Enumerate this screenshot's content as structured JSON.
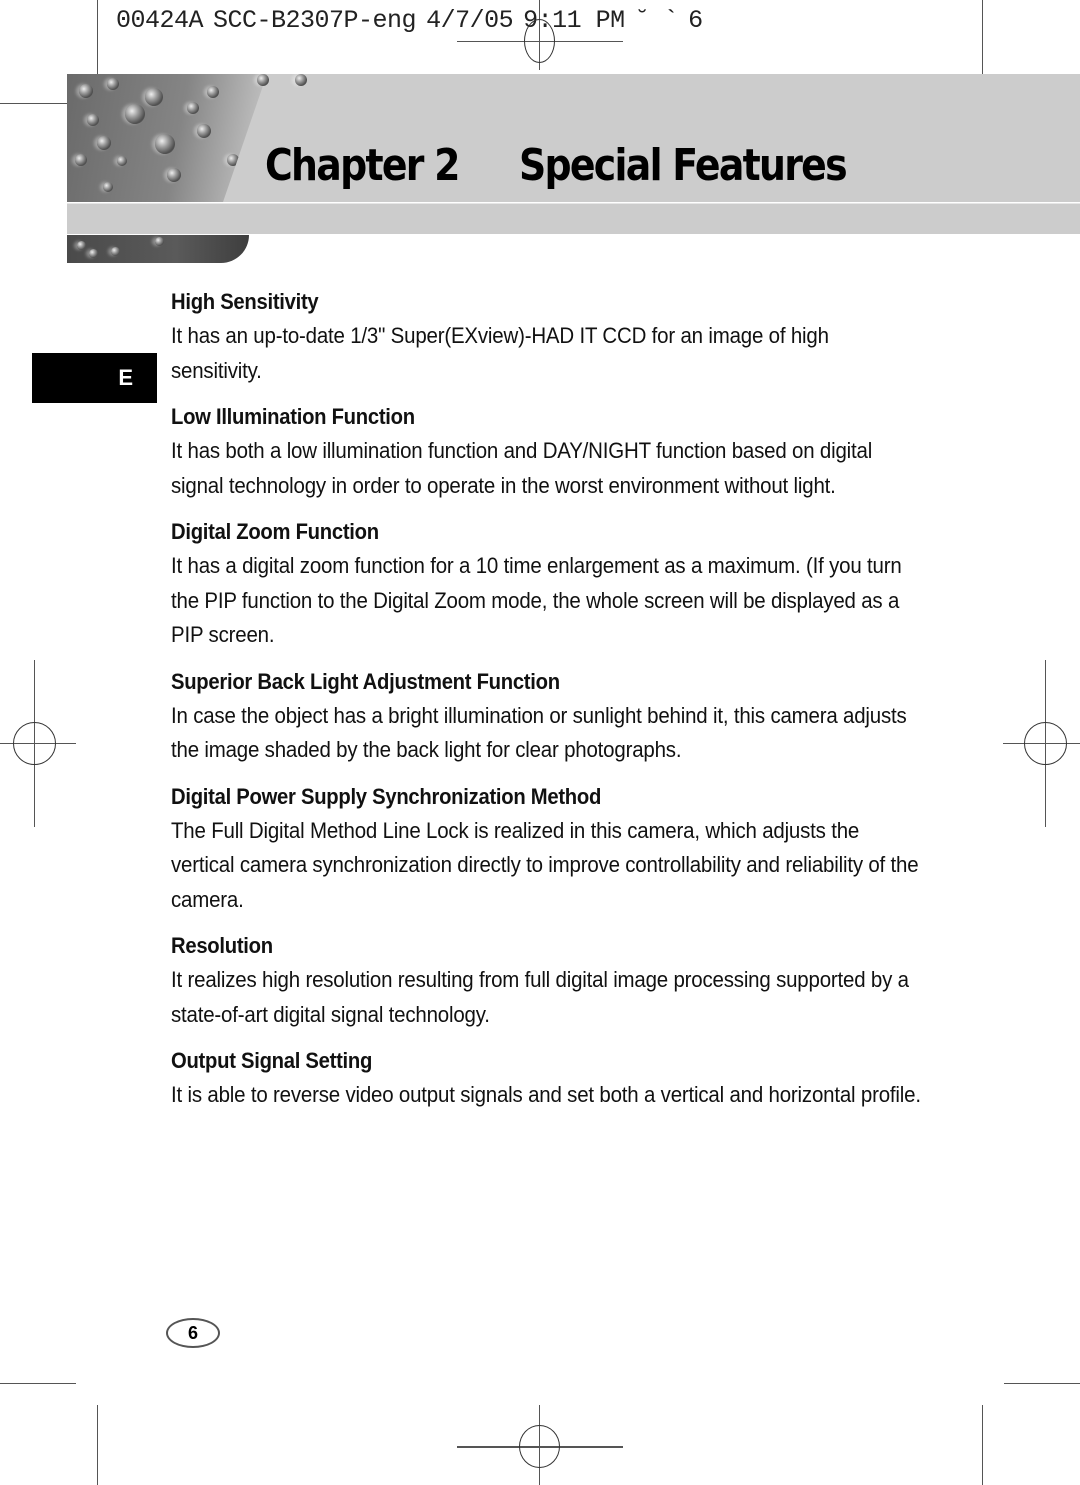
{
  "print_slug": {
    "job_id": "00424A",
    "file_name": "SCC-B2307P-eng",
    "date": "4/7/05",
    "time": "9:11 PM",
    "marks": "˘ `",
    "page": "6"
  },
  "header": {
    "chapter_label": "Chapter 2",
    "chapter_title": "Special Features"
  },
  "language_tab": "E",
  "sections": [
    {
      "heading": "High Sensitivity",
      "body": "It has an up-to-date 1/3\" Super(EXview)-HAD IT CCD for an image of high sensitivity."
    },
    {
      "heading": "Low Illumination Function",
      "body": "It has both a low illumination function and DAY/NIGHT function based on digital signal technology in order to operate in the worst environment without light."
    },
    {
      "heading": "Digital Zoom Function",
      "body": "It has a digital zoom function for a 10 time enlargement as a maximum. (If you turn the PIP function to the Digital Zoom mode, the whole screen will be displayed as a PIP screen."
    },
    {
      "heading": "Superior Back Light Adjustment Function",
      "body": "In case the object has a bright illumination or sunlight behind it, this camera adjusts the image shaded by the back light for clear photographs."
    },
    {
      "heading": "Digital Power Supply Synchronization Method",
      "body": "The Full Digital Method Line Lock is realized in this camera, which adjusts the vertical camera synchronization directly to improve controllability and reliability of the camera."
    },
    {
      "heading": "Resolution",
      "body": "It realizes high resolution resulting from full digital image processing supported by a state-of-art digital signal technology."
    },
    {
      "heading": "Output Signal Setting",
      "body": "It is able to reverse video output signals and set both a vertical and horizontal profile."
    }
  ],
  "footer": {
    "page_number": "6"
  }
}
